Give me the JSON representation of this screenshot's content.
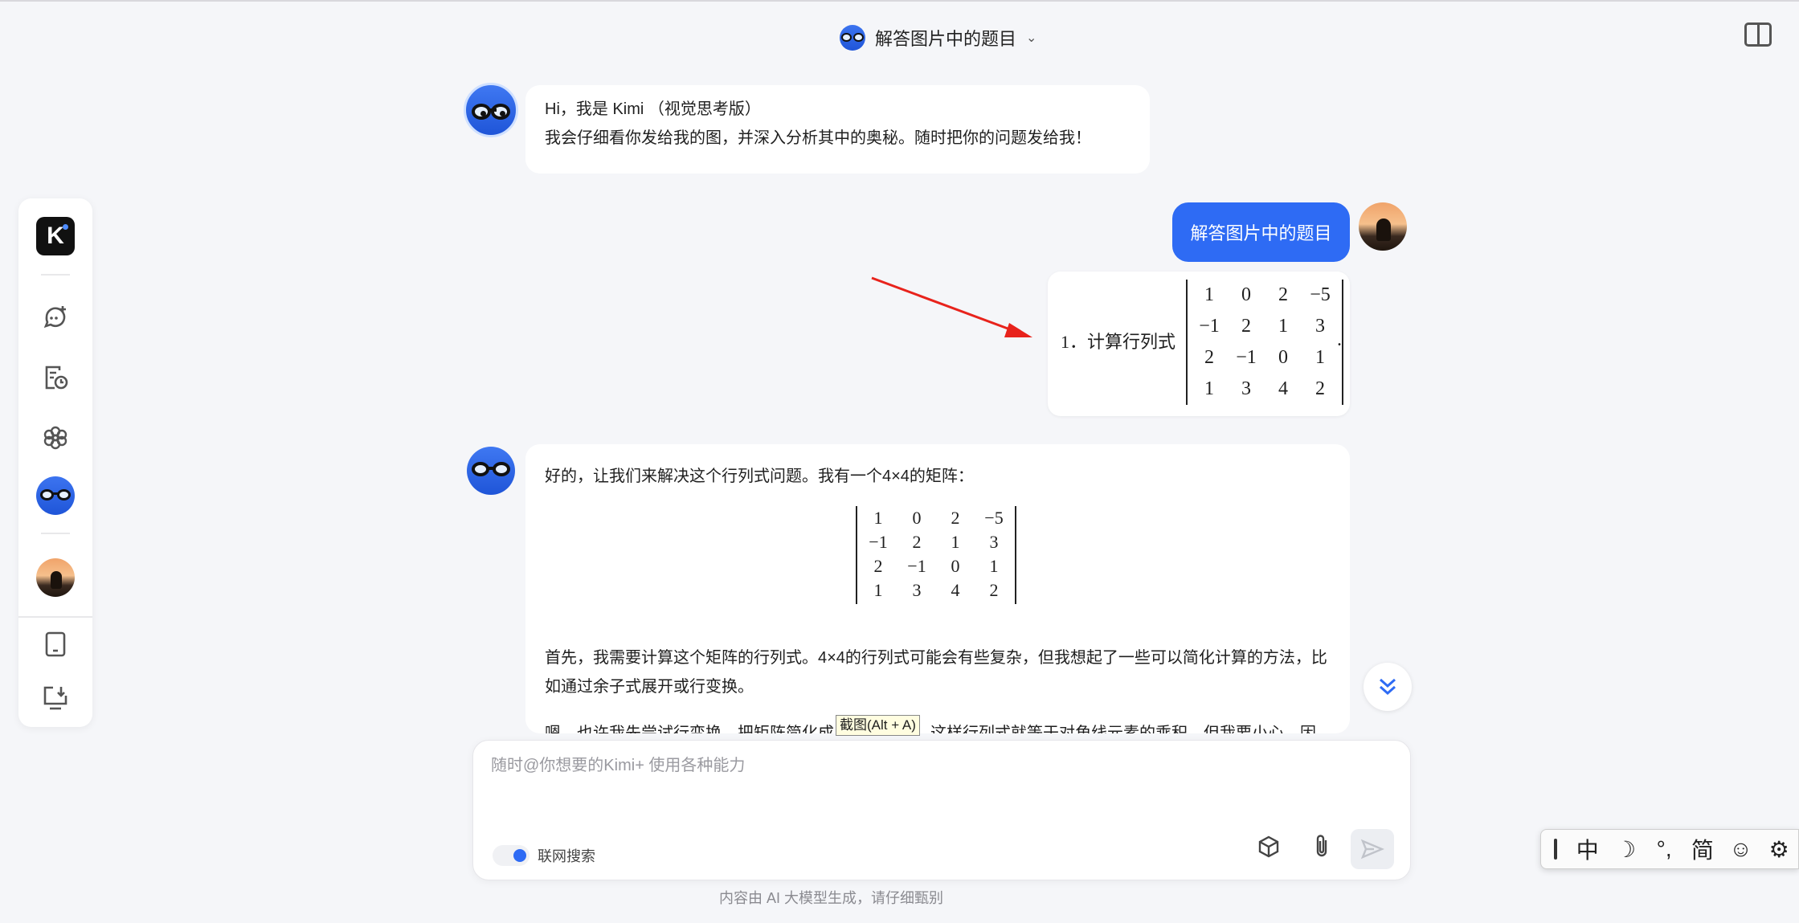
{
  "header": {
    "title": "解答图片中的题目",
    "chevron": "⌄"
  },
  "sidebar": {
    "logo": "K",
    "items": [
      "new-chat",
      "history",
      "explore",
      "kimi-vision",
      "profile",
      "tablet",
      "download"
    ]
  },
  "greeting": {
    "line1": "Hi，我是 Kimi （视觉思考版）",
    "line2": "我会仔细看你发给我的图，并深入分析其中的奥秘。随时把你的问题发给我！"
  },
  "user_message": {
    "text": "解答图片中的题目"
  },
  "problem_image": {
    "label": "1．计算行列式",
    "matrix": [
      [
        "1",
        "0",
        "2",
        "−5"
      ],
      [
        "−1",
        "2",
        "1",
        "3"
      ],
      [
        "2",
        "−1",
        "0",
        "1"
      ],
      [
        "1",
        "3",
        "4",
        "2"
      ]
    ],
    "period": "."
  },
  "answer": {
    "intro": "好的，让我们来解决这个行列式问题。我有一个4×4的矩阵：",
    "matrix": [
      [
        "1",
        "0",
        "2",
        "−5"
      ],
      [
        "−1",
        "2",
        "1",
        "3"
      ],
      [
        "2",
        "−1",
        "0",
        "1"
      ],
      [
        "1",
        "3",
        "4",
        "2"
      ]
    ],
    "para2": "首先，我需要计算这个矩阵的行列式。4×4的行列式可能会有些复杂，但我想起了一些可以简化计算的方法，比如通过余子式展开或行变换。",
    "para3": "嗯，也许我先尝试行变换，把矩阵简化成上三角形式，这样行列式就等于对角线元素的乘积。但我要小心，因为某些行操作会改变行列式的值"
  },
  "tooltip": "截图(Alt + A)",
  "input": {
    "placeholder": "随时@你想要的Kimi+ 使用各种能力",
    "value": ""
  },
  "web_search": {
    "label": "联网搜索",
    "enabled": true
  },
  "disclaimer": "内容由 AI 大模型生成，请仔细甄别",
  "ime": {
    "mode": "中",
    "moon": "☽",
    "punct": "°,",
    "simplified": "简",
    "emoji": "☺",
    "settings": "⚙"
  },
  "colors": {
    "accent": "#2e6bf4",
    "background": "#f5f6f9"
  }
}
